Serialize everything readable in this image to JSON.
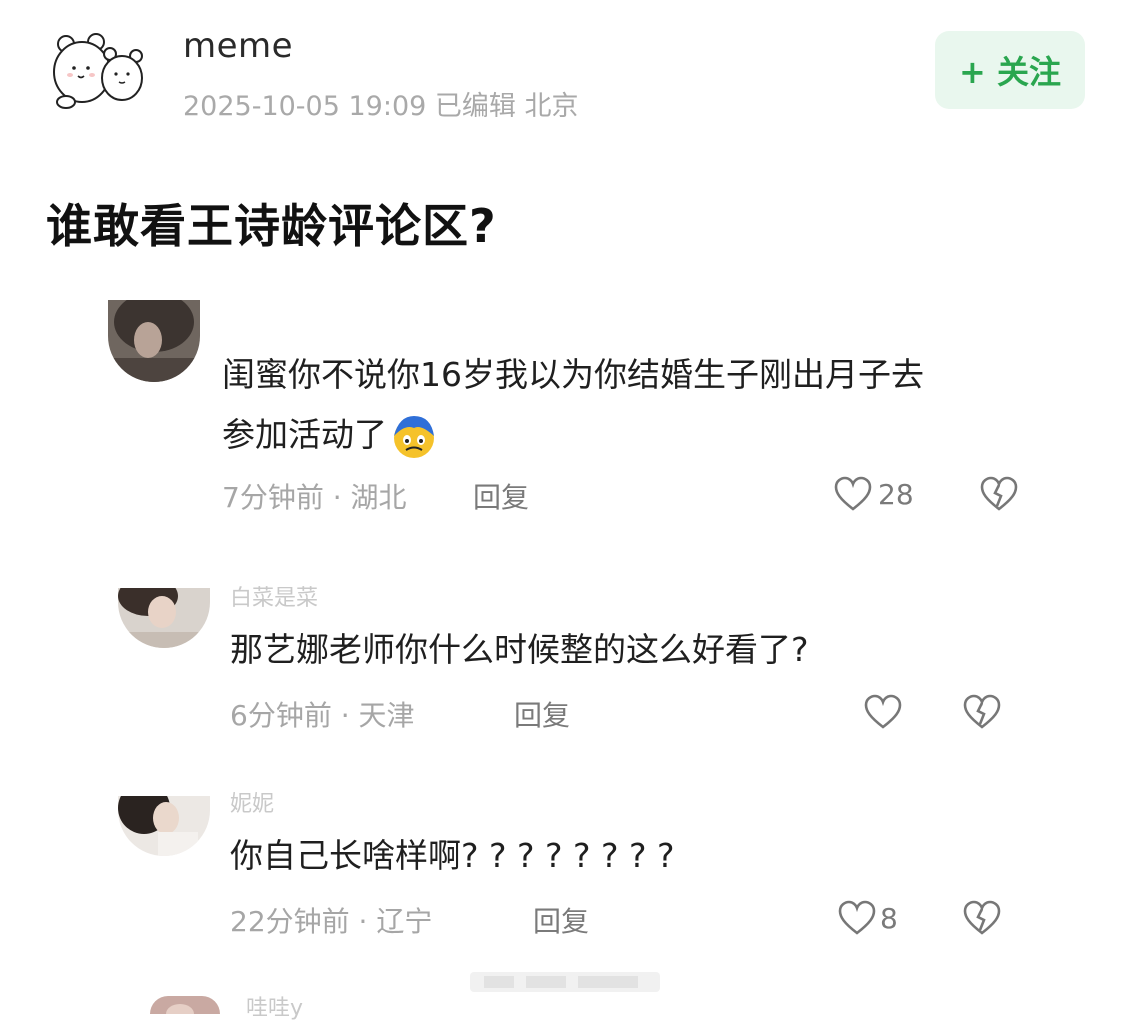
{
  "post": {
    "author": "meme",
    "meta": "2025-10-05 19:09  已编辑  北京",
    "follow_label": "+ 关注",
    "title": "谁敢看王诗龄评论区?"
  },
  "comments": [
    {
      "username": "",
      "text_line1": "闺蜜你不说你16岁我以为你结婚生子刚出月子去",
      "text_line2": "参加活动了",
      "time": "7分钟前",
      "location": "湖北",
      "reply_label": "回复",
      "likes": "28"
    },
    {
      "username": "白菜是菜",
      "text_line1": "那艺娜老师你什么时候整的这么好看了?",
      "time": "6分钟前",
      "location": "天津",
      "reply_label": "回复",
      "likes": ""
    },
    {
      "username": "妮妮",
      "text_line1": "你自己长啥样啊? ? ? ? ? ? ? ?",
      "time": "22分钟前",
      "location": "辽宁",
      "reply_label": "回复",
      "likes": "8"
    }
  ],
  "partial_username": "哇哇y",
  "colors": {
    "follow_bg": "#e9f7ee",
    "follow_text": "#2aa64f",
    "meta_gray": "#a6a6a6"
  },
  "icons": [
    "bear-avatar-icon",
    "heart-outline-icon",
    "broken-heart-icon",
    "crying-emoji-icon"
  ]
}
